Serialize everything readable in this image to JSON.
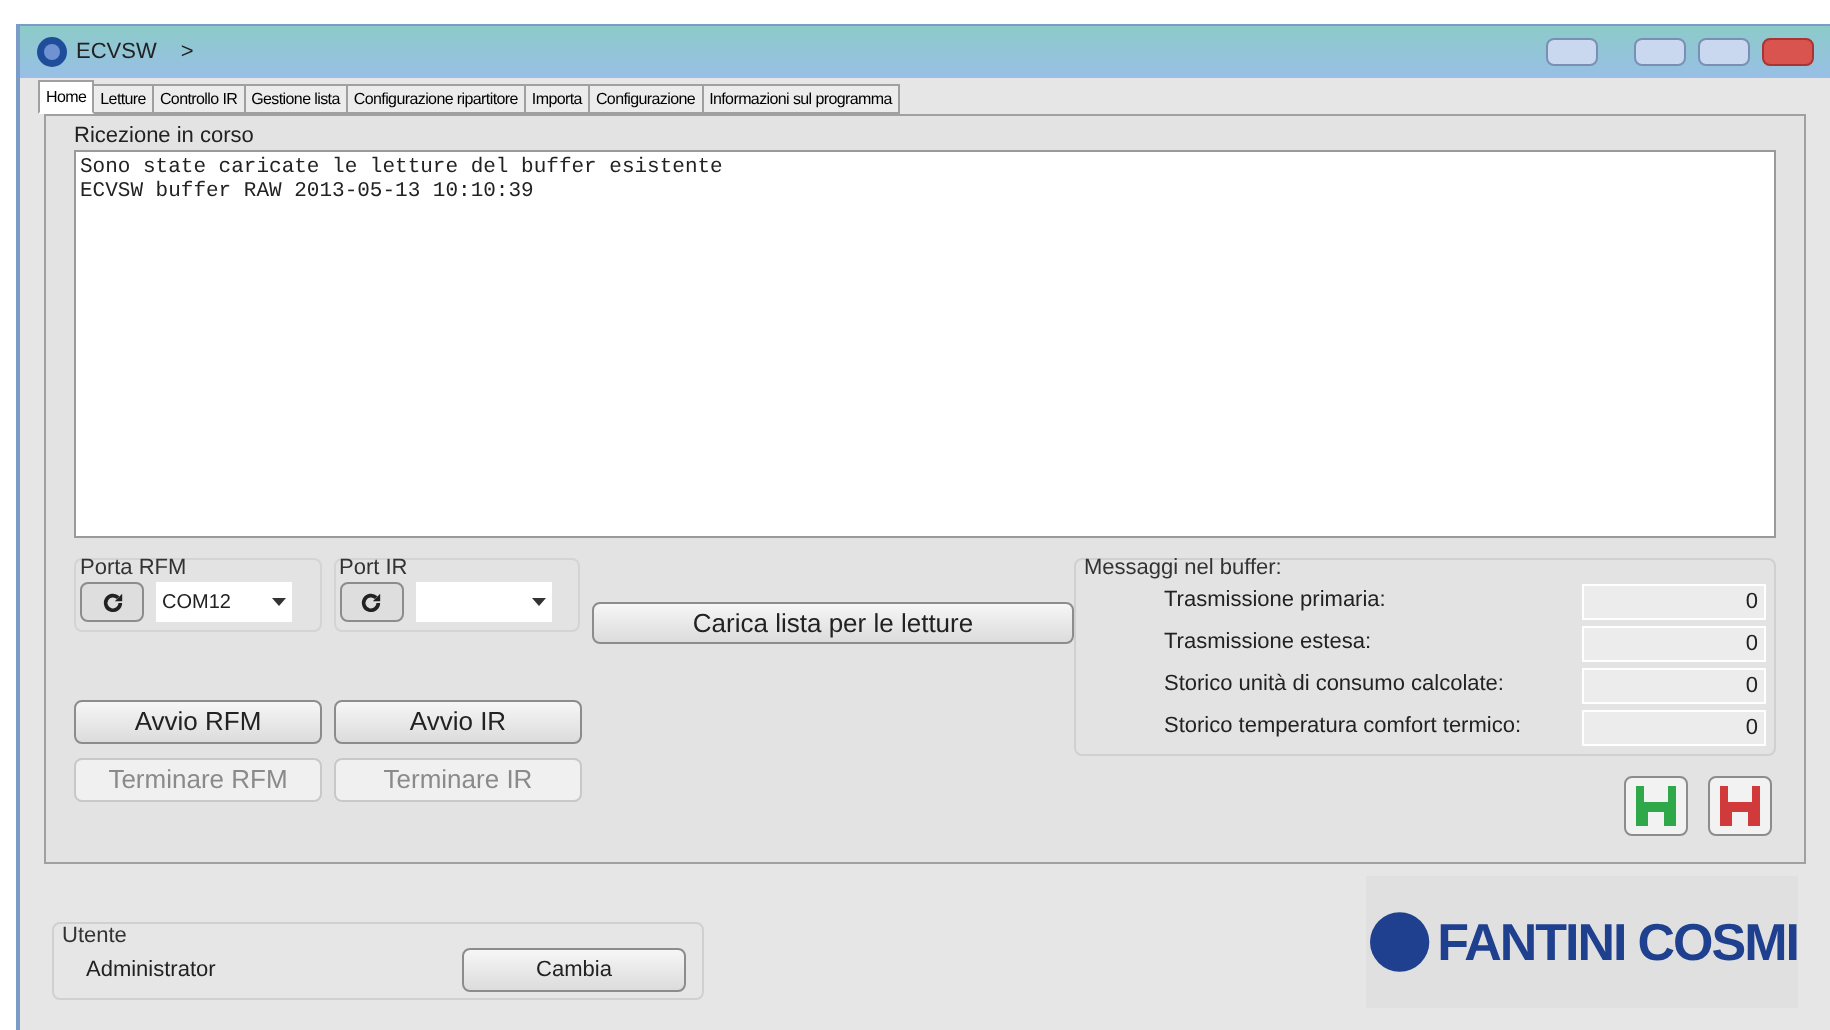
{
  "window": {
    "title": "ECVSW",
    "breadcrumb": ">"
  },
  "tabs": [
    {
      "label": "Home",
      "selected": true
    },
    {
      "label": "Letture",
      "selected": false
    },
    {
      "label": "Controllo IR",
      "selected": false
    },
    {
      "label": "Gestione lista",
      "selected": false
    },
    {
      "label": "Configurazione ripartitore",
      "selected": false
    },
    {
      "label": "Importa",
      "selected": false
    },
    {
      "label": "Configurazione",
      "selected": false
    },
    {
      "label": "Informazioni sul programma",
      "selected": false
    }
  ],
  "reception": {
    "title": "Ricezione in corso",
    "lines": [
      "Sono state caricate le letture del buffer esistente",
      "ECVSW buffer RAW 2013-05-13 10:10:39"
    ]
  },
  "ports": [
    {
      "label": "Porta RFM",
      "value": "COM12"
    },
    {
      "label": "Port IR"
    }
  ],
  "load_button": "Carica lista per le letture",
  "start_buttons": [
    {
      "label": "Avvio RFM",
      "disabled": false
    },
    {
      "label": "Avvio IR",
      "disabled": false
    }
  ],
  "stop_buttons": [
    {
      "label": "Terminare RFM",
      "disabled": true
    },
    {
      "label": "Terminare IR",
      "disabled": true
    }
  ],
  "buffer": {
    "title": "Messaggi nel buffer:",
    "rows": [
      {
        "label": "Trasmissione primaria:",
        "value": "0"
      },
      {
        "label": "Trasmissione estesa:",
        "value": "0"
      },
      {
        "label": "Storico unità di consumo calcolate:",
        "value": "0"
      },
      {
        "label": "Storico temperatura comfort termico:",
        "value": "0"
      }
    ]
  },
  "save_buttons": [
    {
      "color": "#2fa84a"
    },
    {
      "color": "#d13a3a"
    }
  ],
  "user": {
    "title": "Utente",
    "name": "Administrator",
    "button": "Cambia"
  },
  "logo": {
    "word1": "FANTINI",
    "word2": "COSMI"
  }
}
